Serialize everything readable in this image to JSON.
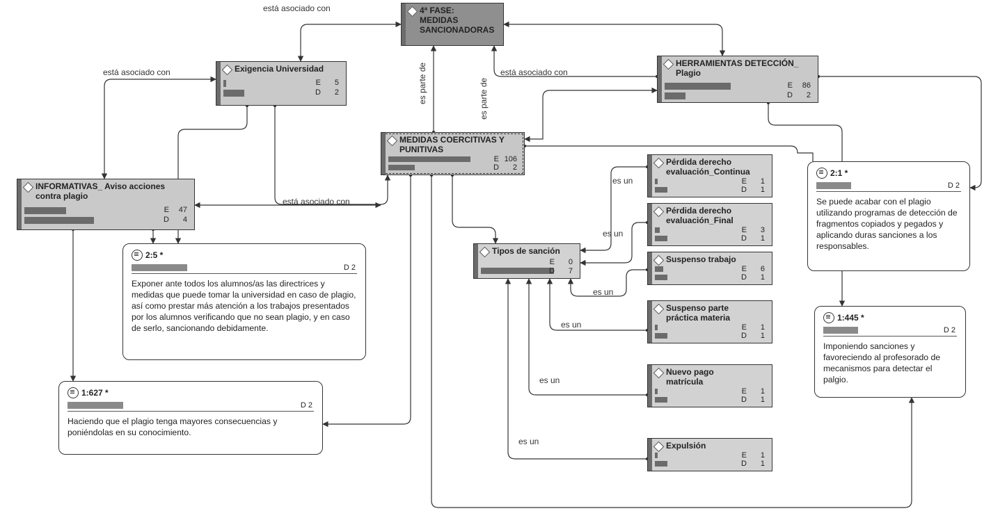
{
  "labels": {
    "asoc": "está asociado con",
    "parte": "es parte de",
    "esun": "es un"
  },
  "nodes": {
    "fase": {
      "title": "4ª FASE:\nMEDIDAS\nSANCIONADORAS"
    },
    "exig": {
      "title": "Exigencia Universidad",
      "E": "5",
      "D": "2"
    },
    "herr": {
      "title": "HERRAMIENTAS DETECCIÓN_\nPlagio",
      "E": "86",
      "D": "2"
    },
    "info": {
      "title": "INFORMATIVAS_ Aviso acciones\ncontra plagio",
      "E": "47",
      "D": "4"
    },
    "coer": {
      "title": "MEDIDAS COERCITIVAS Y\nPUNITIVAS",
      "E": "106",
      "D": "2"
    },
    "tipos": {
      "title": "Tipos de sanción",
      "E": "0",
      "D": "7"
    },
    "s1": {
      "title": "Pérdida derecho\nevaluación_Continua",
      "E": "1",
      "D": "1"
    },
    "s2": {
      "title": "Pérdida derecho\nevaluación_Final",
      "E": "3",
      "D": "1"
    },
    "s3": {
      "title": "Suspenso trabajo",
      "E": "6",
      "D": "1"
    },
    "s4": {
      "title": "Suspenso parte\npráctica materia",
      "E": "1",
      "D": "1"
    },
    "s5": {
      "title": "Nuevo pago\nmatrícula",
      "E": "1",
      "D": "1"
    },
    "s6": {
      "title": "Expulsión",
      "E": "1",
      "D": "1"
    }
  },
  "memos": {
    "m25": {
      "ref": "2:5 *",
      "D": "D  2",
      "text": " Exponer ante todos los alumnos/as las directrices y medidas que puede tomar la universidad en caso de plagio, así como prestar más atención a los trabajos presentados por los alumnos verificando que no sean plagio, y en caso de serlo, sancionando debidamente."
    },
    "m1627": {
      "ref": "1:627 *",
      "D": "D  2",
      "text": " Haciendo que el plagio tenga mayores consecuencias y poniéndolas en su conocimiento."
    },
    "m21": {
      "ref": "2:1 *",
      "D": "D  2",
      "text": "Se puede acabar con el plagio utilizando programas de detección de fragmentos copiados y pegados y aplicando duras sanciones a los responsables."
    },
    "m1445": {
      "ref": "1:445 *",
      "D": "D  2",
      "text": " Imponiendo sanciones y favoreciendo al profesorado de mecanismos para detectar el palgio."
    }
  }
}
